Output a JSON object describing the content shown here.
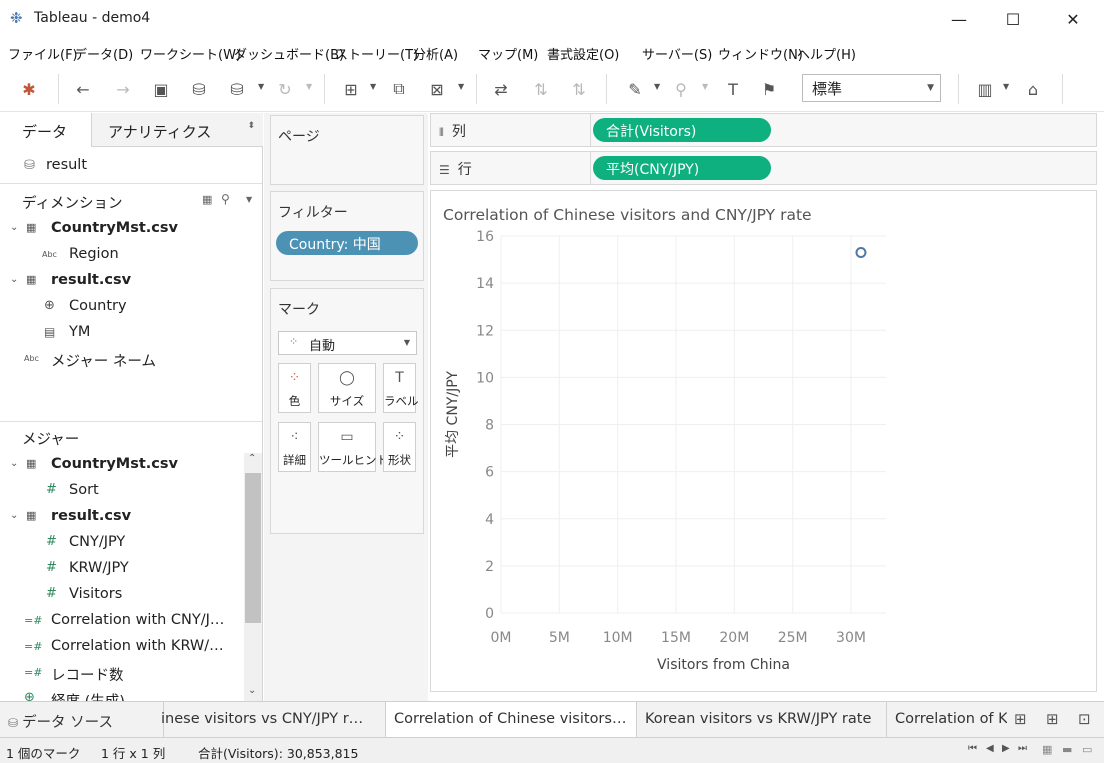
{
  "window": {
    "title": "Tableau - demo4",
    "minimize": "—",
    "maximize": "☐",
    "close": "✕"
  },
  "menu": [
    "ファイル(F)",
    "データ(D)",
    "ワークシート(W)",
    "ダッシュボード(B)",
    "ストーリー(T)",
    "分析(A)",
    "マップ(M)",
    "書式設定(O)",
    "サーバー(S)",
    "ウィンドウ(N)",
    "ヘルプ(H)"
  ],
  "toolbar": {
    "fit_value": "標準"
  },
  "data_pane": {
    "tab_data": "データ",
    "tab_analytics": "アナリティクス",
    "datasource": "result",
    "dimensions_header": "ディメンション",
    "measures_header": "メジャー",
    "dimensions": [
      {
        "label": "CountryMst.csv",
        "bold": true
      },
      {
        "label": "Region",
        "type": "Abc"
      },
      {
        "label": "result.csv",
        "bold": true
      },
      {
        "label": "Country"
      },
      {
        "label": "YM"
      },
      {
        "label": "メジャー ネーム",
        "type": "Abc"
      }
    ],
    "measures": [
      {
        "label": "CountryMst.csv",
        "bold": true
      },
      {
        "label": "Sort"
      },
      {
        "label": "result.csv",
        "bold": true
      },
      {
        "label": "CNY/JPY"
      },
      {
        "label": "KRW/JPY"
      },
      {
        "label": "Visitors"
      },
      {
        "label": "Correlation with CNY/J…"
      },
      {
        "label": "Correlation with KRW/…"
      },
      {
        "label": "レコード数"
      },
      {
        "label": "経度 (生成)"
      }
    ]
  },
  "cards": {
    "pages": "ページ",
    "filters": "フィルター",
    "filter_pill": "Country: 中国",
    "marks": "マーク",
    "mark_type": "自動",
    "mark_buttons": [
      "色",
      "サイズ",
      "ラベル",
      "詳細",
      "ツールヒント",
      "形状"
    ]
  },
  "shelves": {
    "columns_label": "列",
    "columns_pill": "合計(Visitors)",
    "rows_label": "行",
    "rows_pill": "平均(CNY/JPY)"
  },
  "chart_data": {
    "type": "scatter",
    "title": "Correlation of Chinese visitors and CNY/JPY rate",
    "xlabel": "Visitors from China",
    "ylabel": "平均 CNY/JPY",
    "x_ticks": [
      "0M",
      "5M",
      "10M",
      "15M",
      "20M",
      "25M",
      "30M"
    ],
    "y_ticks": [
      "0",
      "2",
      "4",
      "6",
      "8",
      "10",
      "12",
      "14",
      "16"
    ],
    "xlim": [
      0,
      33000000
    ],
    "ylim": [
      0,
      16
    ],
    "points": [
      {
        "x": 30853815,
        "y": 15.3
      }
    ],
    "grid": true
  },
  "sheet_tabs": {
    "datasource": "データ ソース",
    "tabs": [
      "Chinese visitors vs CNY/JPY r…",
      "Correlation of Chinese visitors…",
      "Korean visitors vs KRW/JPY rate",
      "Correlation of K"
    ],
    "tabs_display": [
      "inese visitors vs CNY/JPY r…",
      "Correlation of Chinese visitors…",
      "Korean visitors vs KRW/JPY rate",
      "Correlation of K"
    ]
  },
  "status": {
    "marks": "1 個のマーク",
    "rowscols": "1 行 x 1 列",
    "sum": "合計(Visitors): 30,853,815"
  }
}
